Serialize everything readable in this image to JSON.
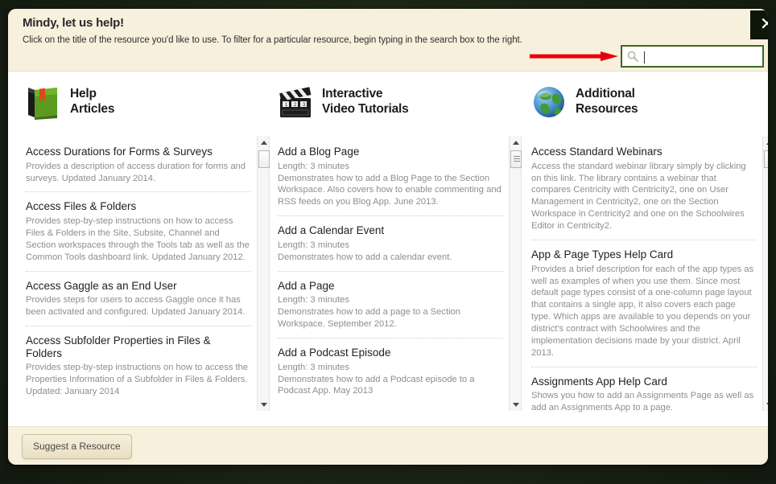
{
  "header": {
    "title": "Mindy, let us help!",
    "subtitle": "Click on the title of the resource you'd like to use. To filter for a particular resource, begin typing in the search box to the right.",
    "search_placeholder": "",
    "search_value": "",
    "search_icon": "search-icon",
    "close_label": "✕",
    "arrow_annotation_color": "#e8000a",
    "search_border_color": "#3d6622"
  },
  "columns": [
    {
      "icon": "green-book-icon",
      "title_line1": "Help",
      "title_line2": "Articles",
      "items": [
        {
          "title": "Access Durations for Forms & Surveys",
          "desc": "Provides a description of access duration for forms and surveys. Updated January 2014."
        },
        {
          "title": "Access Files & Folders",
          "desc": "Provides step-by-step instructions on how to access Files & Folders in the Site, Subsite, Channel and Section workspaces through the Tools tab as well as the Common Tools dashboard link. Updated January 2012."
        },
        {
          "title": "Access Gaggle as an End User",
          "desc": "Provides steps for users to access Gaggle once it has been activated and configured. Updated January 2014."
        },
        {
          "title": "Access Subfolder Properties in Files & Folders",
          "desc": "Provides step-by-step instructions on how to access the Properties Information of a Subfolder in Files & Folders. Updated: January 2014"
        }
      ]
    },
    {
      "icon": "clapperboard-icon",
      "title_line1": "Interactive",
      "title_line2": "Video Tutorials",
      "items": [
        {
          "title": "Add a Blog Page",
          "meta": "Length: 3 minutes",
          "desc": "Demonstrates how to add a Blog Page to the Section Workspace. Also covers how to enable commenting and RSS feeds on you Blog App. June 2013."
        },
        {
          "title": "Add a Calendar Event",
          "meta": "Length: 3 minutes",
          "desc": "Demonstrates how to add a calendar event."
        },
        {
          "title": "Add a Page",
          "meta": "Length: 3 minutes",
          "desc": "Demonstrates how to add a page to a Section Workspace. September 2012."
        },
        {
          "title": "Add a Podcast Episode",
          "meta": "Length: 3 minutes",
          "desc": "Demonstrates how to add a Podcast episode to a Podcast App. May 2013"
        }
      ]
    },
    {
      "icon": "globe-icon",
      "title_line1": "Additional",
      "title_line2": "Resources",
      "items": [
        {
          "title": "Access Standard Webinars",
          "desc": "Access the standard webinar library simply by clicking on this link. The library contains a webinar that compares Centricity with Centricity2, one on User Management in Centricity2, one on the Section Workspace in Centricity2 and one on the Schoolwires Editor in Centricity2."
        },
        {
          "title": "App & Page Types Help Card",
          "desc": "Provides a brief description for each of the app types as well as examples of when you use them. Since most default page types consist of a one-column page layout that contains a single app, it also covers each page type. Which apps are available to you depends on your district's contract with Schoolwires and the implementation decisions made by your district. April 2013."
        },
        {
          "title": "Assignments App Help Card",
          "desc": "Shows you how to add an Assignments Page as well as add an Assignments App to a page."
        }
      ]
    }
  ],
  "footer": {
    "suggest_label": "Suggest a Resource"
  }
}
